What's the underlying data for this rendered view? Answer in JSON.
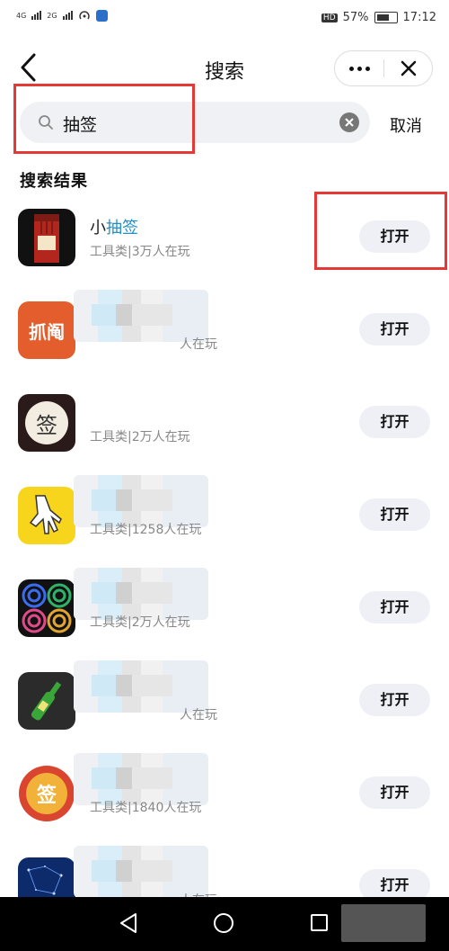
{
  "status": {
    "left_sig1": "4G",
    "left_sig2": "2G",
    "battery_percent": "57%",
    "time": "17:12",
    "hd": "HD"
  },
  "header": {
    "title": "搜索"
  },
  "search": {
    "query": "抽签",
    "cancel_label": "取消"
  },
  "section_title": "搜索结果",
  "results": [
    {
      "name_prefix": "小",
      "name_highlight": "抽签",
      "meta": "工具类|3万人在玩",
      "open_label": "打开",
      "icon": "firecracker-icon"
    },
    {
      "meta": "人在玩",
      "open_label": "打开",
      "icon": "zhuajiu-icon",
      "icon_text": "抓阄"
    },
    {
      "meta": "工具类|2万人在玩",
      "open_label": "打开",
      "icon": "qian-icon",
      "icon_text": "签"
    },
    {
      "meta": "工具类|1258人在玩",
      "open_label": "打开",
      "icon": "hand-icon"
    },
    {
      "meta": "工具类|2万人在玩",
      "open_label": "打开",
      "icon": "circles-icon"
    },
    {
      "meta": "人在玩",
      "open_label": "打开",
      "icon": "bottle-icon"
    },
    {
      "meta": "工具类|1840人在玩",
      "open_label": "打开",
      "icon": "coin-icon",
      "icon_text": "签"
    },
    {
      "meta": "人在玩",
      "open_label": "打开",
      "icon": "stars-icon"
    }
  ],
  "colors": {
    "highlight_red": "#e53935",
    "keyword_blue": "#1e8fc9"
  }
}
